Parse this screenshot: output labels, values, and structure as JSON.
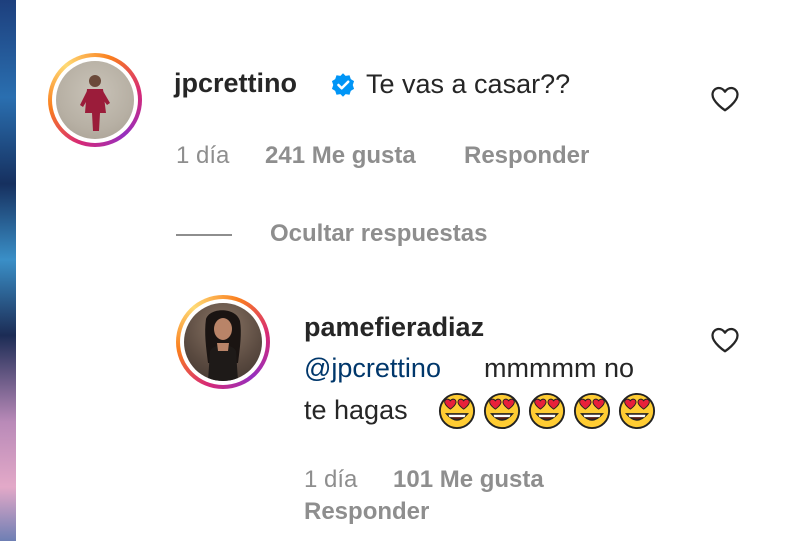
{
  "comment": {
    "username": "jpcrettino",
    "verified_icon": "verified-badge-icon",
    "text": "Te vas a casar??",
    "time": "1 día",
    "likes": "241 Me gusta",
    "reply": "Responder",
    "like_icon": "heart-outline-icon"
  },
  "replies_toggle": {
    "label": "Ocultar respuestas"
  },
  "reply": {
    "username": "pamefieradiaz",
    "mention": "@jpcrettino",
    "text_line1": "mmmmm no",
    "text_line2": "te hagas",
    "emoji_count": 5,
    "emoji_icon": "heart-eyes-emoji",
    "time": "1 día",
    "likes": "101 Me gusta",
    "reply": "Responder",
    "like_icon": "heart-outline-icon"
  },
  "colors": {
    "text": "#262626",
    "muted": "#8e8e8e",
    "mention": "#00376b",
    "verified": "#0095f6"
  }
}
